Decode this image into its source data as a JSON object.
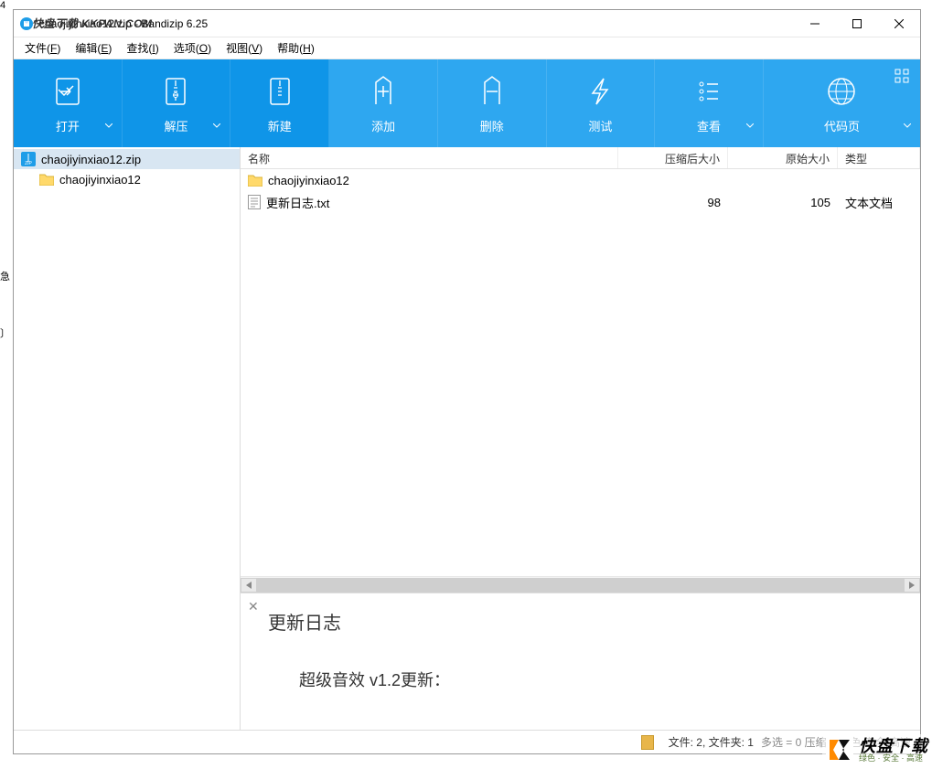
{
  "edge": {
    "t1": "4",
    "t2": "急",
    "t3": "〕"
  },
  "titlebar": {
    "title": "chaojiyinxiao12.zip - Bandizip 6.25",
    "overlay": "快盘下载 KKPAN.COM"
  },
  "menus": [
    {
      "label": "文件",
      "key": "F"
    },
    {
      "label": "编辑",
      "key": "E"
    },
    {
      "label": "查找",
      "key": "I"
    },
    {
      "label": "选项",
      "key": "O"
    },
    {
      "label": "视图",
      "key": "V"
    },
    {
      "label": "帮助",
      "key": "H"
    }
  ],
  "toolbar": {
    "open": "打开",
    "extract": "解压",
    "new": "新建",
    "add": "添加",
    "delete": "删除",
    "test": "测试",
    "view": "查看",
    "codepage": "代码页"
  },
  "tree": [
    {
      "name": "chaojiyinxiao12.zip",
      "icon": "zip",
      "selected": true
    },
    {
      "name": "chaojiyinxiao12",
      "icon": "folder",
      "child": true
    }
  ],
  "columns": {
    "name": "名称",
    "compressed": "压缩后大小",
    "original": "原始大小",
    "type": "类型"
  },
  "files": [
    {
      "name": "chaojiyinxiao12",
      "icon": "folder",
      "compressed": "",
      "original": "",
      "type": ""
    },
    {
      "name": "更新日志.txt",
      "icon": "text",
      "compressed": "98",
      "original": "105",
      "type": "文本文档"
    }
  ],
  "preview": {
    "heading": "更新日志",
    "body": "超级音效 v1.2更新："
  },
  "status": {
    "text": "文件: 2, 文件夹: 1",
    "tail": "多选 = 0  压缩 = 绿色  安全  高速"
  },
  "watermark": {
    "big": "快盘下载",
    "small": "绿色 · 安全 · 高速"
  }
}
